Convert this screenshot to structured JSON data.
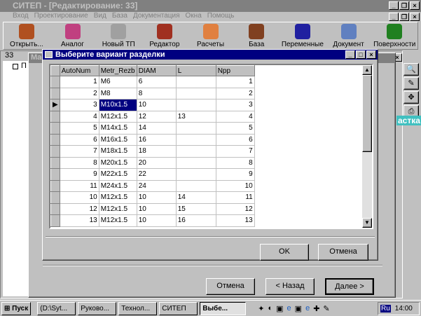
{
  "app_title": "СИТЕП - [Редактирование: 33]",
  "menu": [
    "Вход",
    "Проектирование",
    "Вид",
    "База",
    "Документация",
    "Окна",
    "Помощь"
  ],
  "toolbar": [
    {
      "label": "Открыть...",
      "icon": "open-icon",
      "color": "#b05020"
    },
    {
      "label": "Аналог",
      "icon": "analog-icon",
      "color": "#c04080"
    },
    {
      "label": "Новый ТП",
      "icon": "new-tp-icon",
      "color": "#a0a0a0"
    },
    {
      "label": "Редактор",
      "icon": "editor-icon",
      "color": "#a03020"
    },
    {
      "label": "Расчеты",
      "icon": "calculator-icon",
      "color": "#e08040"
    },
    {
      "label": "База",
      "icon": "database-icon",
      "color": "#804020"
    },
    {
      "label": "Переменные",
      "icon": "fx-icon",
      "color": "#2020a0"
    },
    {
      "label": "Документ",
      "icon": "document-icon",
      "color": "#6080c0"
    },
    {
      "label": "Поверхности",
      "icon": "surfaces-icon",
      "color": "#208020"
    }
  ],
  "child_window": {
    "title": "33",
    "tree_item": "П",
    "behind_title": "Mac"
  },
  "right_text": "астка",
  "dialog": {
    "title": "Выберите вариант разделки",
    "columns": [
      "AutoNum",
      "Metr_Rezb",
      "DIAM",
      "L",
      "Npp"
    ],
    "rows": [
      [
        "1",
        "M6",
        "6",
        "",
        "1"
      ],
      [
        "2",
        "M8",
        "8",
        "",
        "2"
      ],
      [
        "3",
        "M10x1.5",
        "10",
        "",
        "3"
      ],
      [
        "4",
        "M12x1.5",
        "12",
        "13",
        "4"
      ],
      [
        "5",
        "M14x1.5",
        "14",
        "",
        "5"
      ],
      [
        "6",
        "M16x1.5",
        "16",
        "",
        "6"
      ],
      [
        "7",
        "M18x1.5",
        "18",
        "",
        "7"
      ],
      [
        "8",
        "M20x1.5",
        "20",
        "",
        "8"
      ],
      [
        "9",
        "M22x1.5",
        "22",
        "",
        "9"
      ],
      [
        "11",
        "M24x1.5",
        "24",
        "",
        "10"
      ],
      [
        "10",
        "M12x1.5",
        "10",
        "14",
        "11"
      ],
      [
        "12",
        "M12x1.5",
        "10",
        "15",
        "12"
      ],
      [
        "13",
        "M12x1.5",
        "10",
        "16",
        "13"
      ]
    ],
    "current_row": 2,
    "ok": "OK",
    "cancel": "Отмена"
  },
  "wizard": {
    "cancel": "Отмена",
    "back": "< Назад",
    "next": "Далее >"
  },
  "taskbar": {
    "start": "Пуск",
    "items": [
      "(D:\\Syt...",
      "Руково...",
      "Технол...",
      "СИТЕП",
      "Выбе..."
    ],
    "lang": "Ru",
    "clock": "14:00"
  }
}
